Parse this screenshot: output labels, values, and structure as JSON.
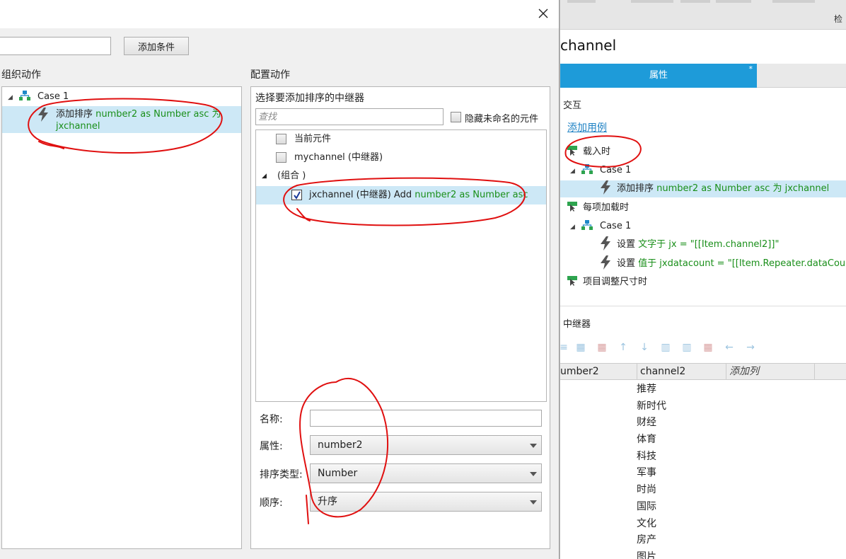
{
  "background_pane": {
    "top_label": "检",
    "name_title": "channel",
    "tab_properties": "属性",
    "tab_star": "*",
    "section_interaction": "交互",
    "add_usecase": "添加用例",
    "events": [
      {
        "label": "载入时"
      },
      {
        "label": "每项加载时"
      },
      {
        "label": "项目调整尺寸时"
      }
    ],
    "case1_label": "Case 1",
    "case2_label": "Case 1",
    "action_sort_prefix": "添加排序",
    "action_sort_detail": "number2 as Number asc 为 jxchannel",
    "action_set1_prefix": "设置",
    "action_set1_detail": "文字于 jx = \"[[Item.channel2]]\"",
    "action_set2_prefix": "设置",
    "action_set2_detail": "值于 jxdatacount = \"[[Item.Repeater.dataCount]]\"",
    "section_repeater": "中继器",
    "grid_headers": [
      "umber2",
      "channel2",
      "添加列"
    ],
    "grid_rows": [
      "推荐",
      "新时代",
      "财经",
      "体育",
      "科技",
      "军事",
      "时尚",
      "国际",
      "文化",
      "房产",
      "图片"
    ]
  },
  "dialog": {
    "condition_input_value": "",
    "add_condition_button": "添加条件",
    "organize_label": "组织动作",
    "configure_label": "配置动作",
    "organize_tree": {
      "case_label": "Case 1",
      "action_prefix": "添加排序",
      "action_detail_line1": "number2 as Number asc 为",
      "action_detail_line2": "jxchannel"
    },
    "pick_title": "选择要添加排序的中继器",
    "find_placeholder": "查找",
    "hide_unnamed_label": "隐藏未命名的元件",
    "widgets": [
      {
        "label": "当前元件",
        "checked": false
      },
      {
        "label": "mychannel (中继器)",
        "checked": false
      }
    ],
    "group_label": "(组合 )",
    "group_child_label": "jxchannel (中继器) Add",
    "group_child_detail": "number2 as Number asc",
    "group_child_checked": true,
    "name_label": "名称:",
    "name_value": "",
    "property_label": "属性:",
    "property_value": "number2",
    "sort_type_label": "排序类型:",
    "sort_type_value": "Number",
    "order_label": "顺序:",
    "order_value": "升序"
  },
  "colors": {
    "accent_blue": "#1e9bd9",
    "selection_blue": "#cde8f6",
    "action_green": "#1a8f1a",
    "link_blue": "#1f82c4",
    "annotation_red": "#e01010",
    "event_icon_green": "#2ea44f"
  }
}
